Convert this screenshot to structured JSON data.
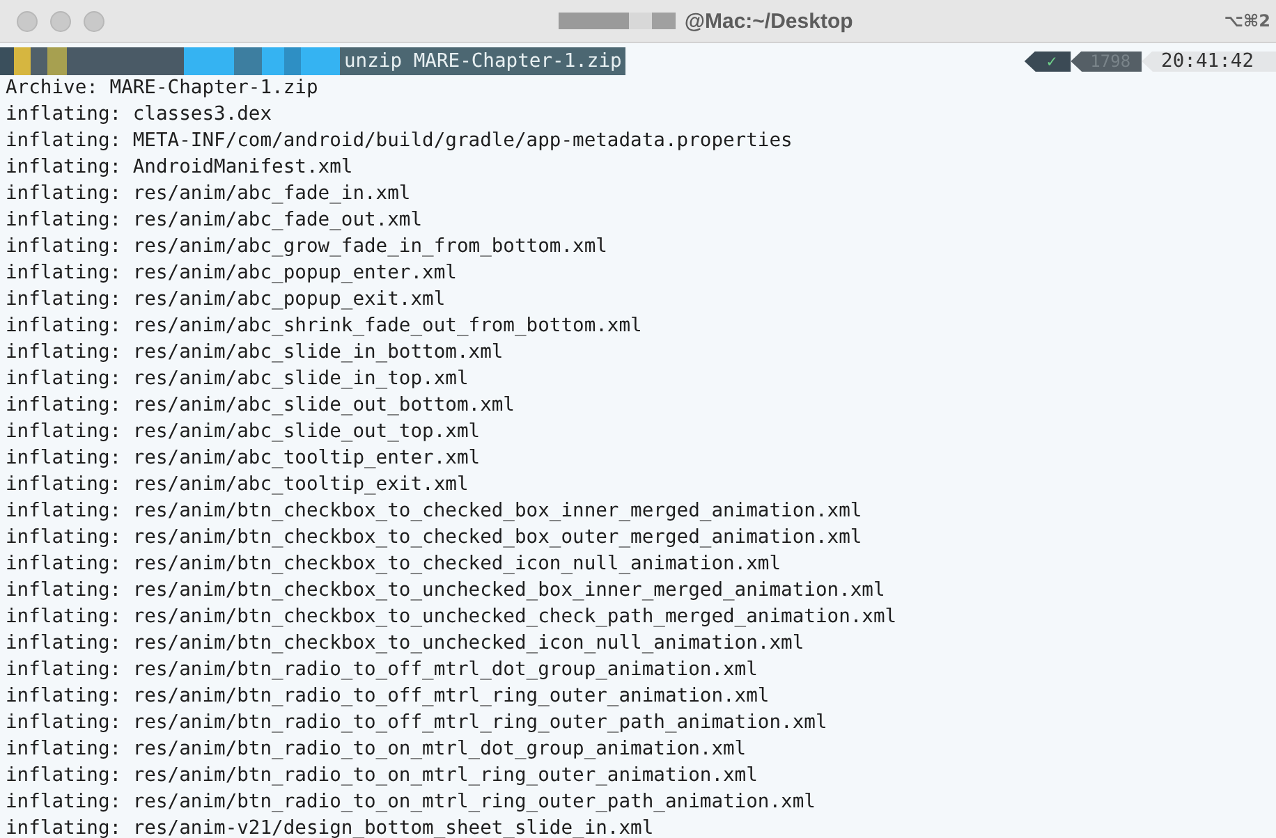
{
  "window": {
    "title": "@Mac:~/Desktop",
    "shortcut": "⌥⌘2"
  },
  "prompt": {
    "command": "unzip MARE-Chapter-1.zip",
    "status": "✓",
    "history_number": "1798",
    "time": "20:41:42"
  },
  "archive": {
    "label": "Archive:",
    "file": "MARE-Chapter-1.zip"
  },
  "output_lines": [
    {
      "action": "inflating:",
      "file": "classes3.dex"
    },
    {
      "action": "inflating:",
      "file": "META-INF/com/android/build/gradle/app-metadata.properties"
    },
    {
      "action": "inflating:",
      "file": "AndroidManifest.xml"
    },
    {
      "action": "inflating:",
      "file": "res/anim/abc_fade_in.xml"
    },
    {
      "action": "inflating:",
      "file": "res/anim/abc_fade_out.xml"
    },
    {
      "action": "inflating:",
      "file": "res/anim/abc_grow_fade_in_from_bottom.xml"
    },
    {
      "action": "inflating:",
      "file": "res/anim/abc_popup_enter.xml"
    },
    {
      "action": "inflating:",
      "file": "res/anim/abc_popup_exit.xml"
    },
    {
      "action": "inflating:",
      "file": "res/anim/abc_shrink_fade_out_from_bottom.xml"
    },
    {
      "action": "inflating:",
      "file": "res/anim/abc_slide_in_bottom.xml"
    },
    {
      "action": "inflating:",
      "file": "res/anim/abc_slide_in_top.xml"
    },
    {
      "action": "inflating:",
      "file": "res/anim/abc_slide_out_bottom.xml"
    },
    {
      "action": "inflating:",
      "file": "res/anim/abc_slide_out_top.xml"
    },
    {
      "action": "inflating:",
      "file": "res/anim/abc_tooltip_enter.xml"
    },
    {
      "action": "inflating:",
      "file": "res/anim/abc_tooltip_exit.xml"
    },
    {
      "action": "inflating:",
      "file": "res/anim/btn_checkbox_to_checked_box_inner_merged_animation.xml"
    },
    {
      "action": "inflating:",
      "file": "res/anim/btn_checkbox_to_checked_box_outer_merged_animation.xml"
    },
    {
      "action": "inflating:",
      "file": "res/anim/btn_checkbox_to_checked_icon_null_animation.xml"
    },
    {
      "action": "inflating:",
      "file": "res/anim/btn_checkbox_to_unchecked_box_inner_merged_animation.xml"
    },
    {
      "action": "inflating:",
      "file": "res/anim/btn_checkbox_to_unchecked_check_path_merged_animation.xml"
    },
    {
      "action": "inflating:",
      "file": "res/anim/btn_checkbox_to_unchecked_icon_null_animation.xml"
    },
    {
      "action": "inflating:",
      "file": "res/anim/btn_radio_to_off_mtrl_dot_group_animation.xml"
    },
    {
      "action": "inflating:",
      "file": "res/anim/btn_radio_to_off_mtrl_ring_outer_animation.xml"
    },
    {
      "action": "inflating:",
      "file": "res/anim/btn_radio_to_off_mtrl_ring_outer_path_animation.xml"
    },
    {
      "action": "inflating:",
      "file": "res/anim/btn_radio_to_on_mtrl_dot_group_animation.xml"
    },
    {
      "action": "inflating:",
      "file": "res/anim/btn_radio_to_on_mtrl_ring_outer_animation.xml"
    },
    {
      "action": "inflating:",
      "file": "res/anim/btn_radio_to_on_mtrl_ring_outer_path_animation.xml"
    },
    {
      "action": "inflating:",
      "file": "res/anim-v21/design_bottom_sheet_slide_in.xml"
    }
  ]
}
